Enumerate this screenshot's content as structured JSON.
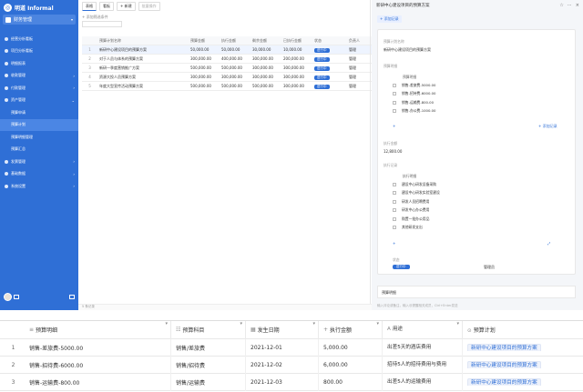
{
  "app": {
    "name": "明道 Informal"
  },
  "workspace": {
    "name": "财务管理"
  },
  "sidebar": {
    "items": [
      {
        "label": "经营分析看板",
        "type": "top"
      },
      {
        "label": "项目分析看板",
        "type": "top"
      },
      {
        "label": "明细报表",
        "type": "top"
      },
      {
        "label": "收款管理",
        "type": "top",
        "chev": "›"
      },
      {
        "label": "付款管理",
        "type": "top",
        "chev": "›"
      },
      {
        "label": "资产管理",
        "type": "top",
        "chev": "⌄"
      },
      {
        "label": "预算申请",
        "type": "sub"
      },
      {
        "label": "预算计划",
        "type": "sub",
        "active": true
      },
      {
        "label": "预算明细管理",
        "type": "sub"
      },
      {
        "label": "预算汇总",
        "type": "sub"
      },
      {
        "label": "发票管理",
        "type": "top",
        "chev": "›"
      },
      {
        "label": "基础数据",
        "type": "top",
        "chev": "›"
      },
      {
        "label": "系统设置",
        "type": "top",
        "chev": "›"
      }
    ]
  },
  "toolbar": {
    "buttons": [
      "表格",
      "看板",
      "+ 新建",
      "批量操作"
    ],
    "add_label": "+ 添加筛选条件",
    "search_placeholder": ""
  },
  "main_table": {
    "headers": [
      "预算计划名称",
      "预算金额",
      "执行金额",
      "剩余金额",
      "已执行金额",
      "状态",
      "负责人"
    ],
    "rows": [
      {
        "idx": "1",
        "name": "新研中心建设项目的预算方案",
        "v1": "50,000.00",
        "v2": "50,000.00",
        "v3": "30,000.00",
        "v4": "10,000.00",
        "status": "进行中",
        "owner": "管理"
      },
      {
        "idx": "2",
        "name": "对于人员与体系的预算方案",
        "v1": "300,000.00",
        "v2": "400,000.00",
        "v3": "300,000.00",
        "v4": "200,000.00",
        "status": "进行中",
        "owner": "管理"
      },
      {
        "idx": "3",
        "name": "新研一季度营销推广方案",
        "v1": "500,000.00",
        "v2": "500,000.00",
        "v3": "300,000.00",
        "v4": "300,000.00",
        "status": "进行中",
        "owner": "管理"
      },
      {
        "idx": "4",
        "name": "资源大投人员预算方案",
        "v1": "300,000.00",
        "v2": "300,000.00",
        "v3": "300,000.00",
        "v4": "300,000.00",
        "status": "进行中",
        "owner": "管理"
      },
      {
        "idx": "5",
        "name": "年度大型宣传活动预算方案",
        "v1": "500,000.00",
        "v2": "500,000.00",
        "v3": "500,000.00",
        "v4": "300,000.00",
        "status": "进行中",
        "owner": "管理"
      }
    ]
  },
  "footer": {
    "count": "5 条记录"
  },
  "panel": {
    "title": "新研中心建设项目的预算方案",
    "tool_label": "+ 添加记录",
    "field1_label": "预算计划名称",
    "field1_value": "新研中心建设项目的预算方案",
    "field2_label": "预算明细",
    "detail_head": "预算明细",
    "details": [
      "销售-差旅费-5000.00",
      "销售-招待费-6000.00",
      "销售-运输费-800.00",
      "销售-办公费-1000.00"
    ],
    "add_record": "+ 添加记录",
    "field3_label": "执行金额",
    "field3_value": "12,800.00",
    "field4_label": "执行记录",
    "record_head": "执行明细",
    "records": [
      "建设中心研发设备采购",
      "建设中心研发实验室建设",
      "研发人员招聘费用",
      "研发中心办公费用",
      "购置一批办公用品",
      "其他研发支出"
    ],
    "status_label": "状态",
    "status_value": "进行中",
    "owner_value": "管理员",
    "foot_label": "预算明细",
    "input_placeholder": "输入评论或备注，输入@提醒相关成员，Ctrl+Enter发送"
  },
  "bottom_table": {
    "headers": [
      "预算明细",
      "预算科目",
      "发生日期",
      "执行金额",
      "用途",
      "预算计划"
    ],
    "rows": [
      {
        "idx": "1",
        "detail": "销售-差旅费-5000.00",
        "subject": "销售/差旅费",
        "date": "2021-12-01",
        "amount": "5,000.00",
        "use": "出差5天的酒店费用",
        "plan": "新研中心建设项目的预算方案"
      },
      {
        "idx": "2",
        "detail": "销售-招待费-6000.00",
        "subject": "销售/招待费",
        "date": "2021-12-02",
        "amount": "6,000.00",
        "use": "招待5人的招待费用与费用",
        "plan": "新研中心建设项目的预算方案"
      },
      {
        "idx": "3",
        "detail": "销售-运输费-800.00",
        "subject": "销售/运输费",
        "date": "2021-12-03",
        "amount": "800.00",
        "use": "出差5人的运输费用",
        "plan": "新研中心建设项目的预算方案"
      }
    ]
  }
}
